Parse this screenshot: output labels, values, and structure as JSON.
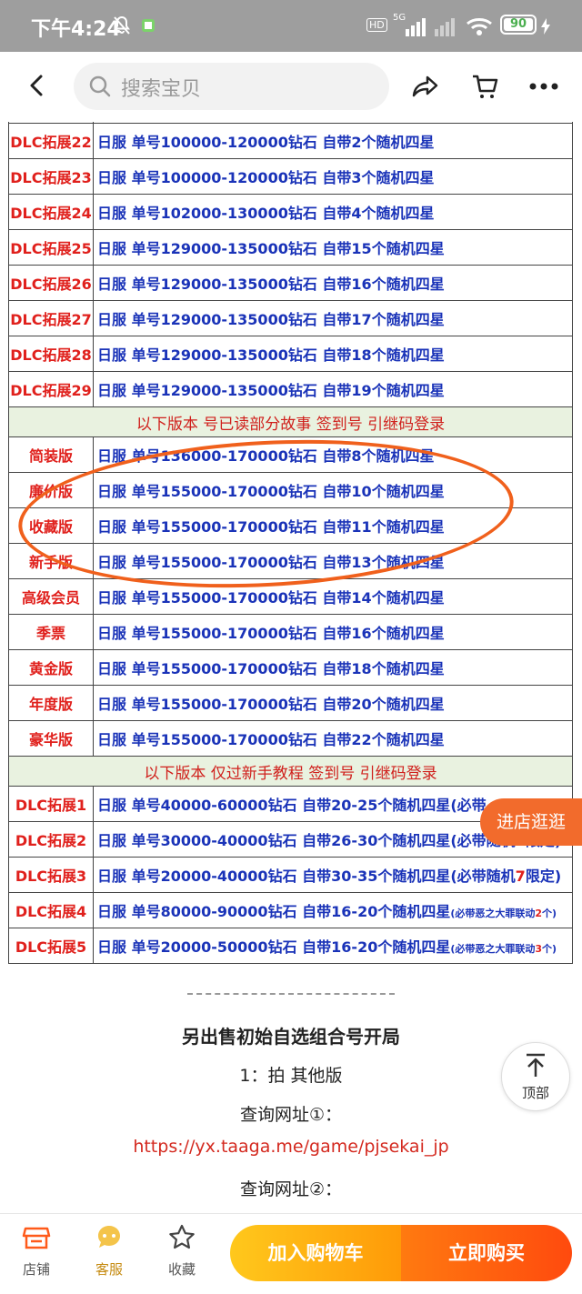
{
  "status_bar": {
    "time": "下午4:24",
    "network": "5G",
    "hd": "HD",
    "battery": "90"
  },
  "nav": {
    "search_placeholder": "搜索宝贝"
  },
  "table": {
    "rows_a": [
      {
        "name": "DLC拓展22",
        "server": "日服",
        "range": "单号100000-120000钻石",
        "bonus": "自带2个随机四星"
      },
      {
        "name": "DLC拓展23",
        "server": "日服",
        "range": "单号100000-120000钻石",
        "bonus": "自带3个随机四星"
      },
      {
        "name": "DLC拓展24",
        "server": "日服",
        "range": "单号102000-130000钻石",
        "bonus": "自带4个随机四星"
      },
      {
        "name": "DLC拓展25",
        "server": "日服",
        "range": "单号129000-135000钻石",
        "bonus": "自带15个随机四星"
      },
      {
        "name": "DLC拓展26",
        "server": "日服",
        "range": "单号129000-135000钻石",
        "bonus": "自带16个随机四星"
      },
      {
        "name": "DLC拓展27",
        "server": "日服",
        "range": "单号129000-135000钻石",
        "bonus": "自带17个随机四星"
      },
      {
        "name": "DLC拓展28",
        "server": "日服",
        "range": "单号129000-135000钻石",
        "bonus": "自带18个随机四星"
      },
      {
        "name": "DLC拓展29",
        "server": "日服",
        "range": "单号129000-135000钻石",
        "bonus": "自带19个随机四星"
      }
    ],
    "section1": "以下版本 号已读部分故事 签到号 引继码登录",
    "rows_b": [
      {
        "name": "简装版",
        "server": "日服",
        "range": "单号136000-170000钻石",
        "bonus": "自带8个随机四星"
      },
      {
        "name": "廉价版",
        "server": "日服",
        "range": "单号155000-170000钻石",
        "bonus": "自带10个随机四星"
      },
      {
        "name": "收藏版",
        "server": "日服",
        "range": "单号155000-170000钻石",
        "bonus": "自带11个随机四星"
      },
      {
        "name": "新手版",
        "server": "日服",
        "range": "单号155000-170000钻石",
        "bonus": "自带13个随机四星"
      },
      {
        "name": "高级会员",
        "server": "日服",
        "range": "单号155000-170000钻石",
        "bonus": "自带14个随机四星"
      },
      {
        "name": "季票",
        "server": "日服",
        "range": "单号155000-170000钻石",
        "bonus": "自带16个随机四星"
      },
      {
        "name": "黄金版",
        "server": "日服",
        "range": "单号155000-170000钻石",
        "bonus": "自带18个随机四星"
      },
      {
        "name": "年度版",
        "server": "日服",
        "range": "单号155000-170000钻石",
        "bonus": "自带20个随机四星"
      },
      {
        "name": "豪华版",
        "server": "日服",
        "range": "单号155000-170000钻石",
        "bonus": "自带22个随机四星"
      }
    ],
    "section2": "以下版本 仅过新手教程 签到号 引继码登录",
    "rows_c": [
      {
        "name": "DLC拓展1",
        "server": "日服",
        "range": "单号40000-60000钻石",
        "bonus": "自带20-25个随机四星(必带",
        "note_pre": "",
        "note_red": "",
        "note_post": ""
      },
      {
        "name": "DLC拓展2",
        "server": "日服",
        "range": "单号30000-40000钻石",
        "bonus": "自带26-30个随机四星",
        "note_pre": "(必带随机",
        "note_red": "7",
        "note_post": "限定)"
      },
      {
        "name": "DLC拓展3",
        "server": "日服",
        "range": "单号20000-40000钻石",
        "bonus": "自带30-35个随机四星",
        "note_pre": "(必带随机",
        "note_red": "7",
        "note_post": "限定)"
      },
      {
        "name": "DLC拓展4",
        "server": "日服",
        "range": "单号80000-90000钻石",
        "bonus": "自带16-20个随机四星",
        "note_pre": "(必带恶之大罪联动",
        "note_red": "2",
        "note_post": "个)"
      },
      {
        "name": "DLC拓展5",
        "server": "日服",
        "range": "单号20000-50000钻石",
        "bonus": "自带16-20个随机四星",
        "note_pre": "(必带恶之大罪联动",
        "note_red": "3",
        "note_post": "个)"
      }
    ]
  },
  "float": {
    "enter_shop": "进店逛逛",
    "top_label": "顶部"
  },
  "desc": {
    "heading": "另出售初始自选组合号开局",
    "line1": "1：拍 其他版",
    "query1": "查询网址①：",
    "url": "https://yx.taaga.me/game/pjsekai_jp",
    "query2": "查询网址②："
  },
  "bottom": {
    "shop": "店铺",
    "service": "客服",
    "favorite": "收藏",
    "add_cart": "加入购物车",
    "buy_now": "立即购买"
  },
  "colors": {
    "accent": "#ff5000",
    "cart": "#ffa808",
    "table_red": "#e0201c",
    "table_blue": "#1a33b8",
    "circle": "#f0601c"
  }
}
